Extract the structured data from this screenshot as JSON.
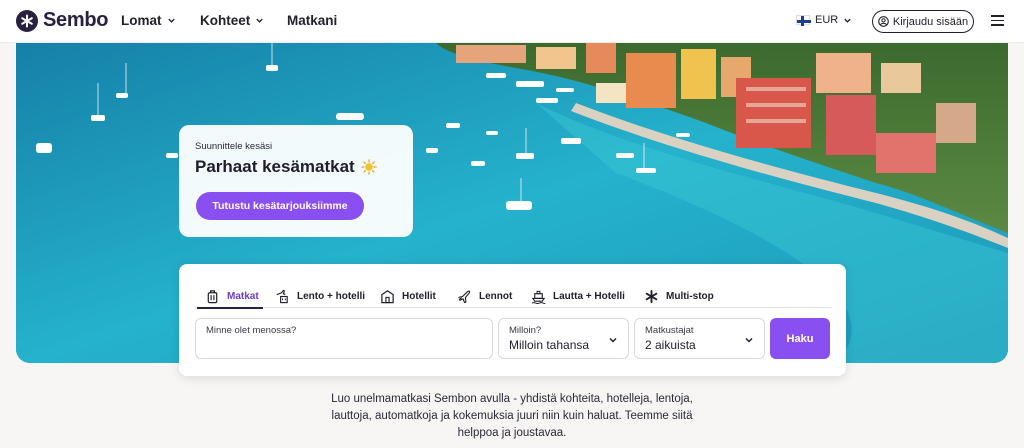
{
  "header": {
    "brand": "Sembo",
    "nav": [
      {
        "label": "Lomat",
        "dropdown": true
      },
      {
        "label": "Kohteet",
        "dropdown": true
      },
      {
        "label": "Matkani",
        "dropdown": false
      }
    ],
    "currency": "EUR",
    "login_label": "Kirjaudu sisään"
  },
  "promo": {
    "subtitle": "Suunnittele kesäsi",
    "title": "Parhaat kesämatkat",
    "button": "Tutustu kesätarjouksiimme"
  },
  "search": {
    "tabs": [
      {
        "label": "Matkat",
        "icon": "luggage-icon",
        "active": true
      },
      {
        "label": "Lento + hotelli",
        "icon": "plane-hotel-icon",
        "active": false
      },
      {
        "label": "Hotellit",
        "icon": "hotel-icon",
        "active": false
      },
      {
        "label": "Lennot",
        "icon": "plane-icon",
        "active": false
      },
      {
        "label": "Lautta + Hotelli",
        "icon": "ferry-icon",
        "active": false
      },
      {
        "label": "Multi-stop",
        "icon": "asterisk-icon",
        "active": false
      }
    ],
    "destination": {
      "placeholder": "Minne olet menossa?"
    },
    "when": {
      "label": "Milloin?",
      "value": "Milloin tahansa"
    },
    "travellers": {
      "label": "Matkustajat",
      "value": "2 aikuista"
    },
    "submit": "Haku"
  },
  "intro_text": "Luo unelmamatkasi Sembon avulla - yhdistä kohteita, hotelleja, lentoja, lauttoja, automatkoja ja kokemuksia juuri niin kuin haluat. Teemme siitä helppoa ja joustavaa.",
  "colors": {
    "brand": "#2a2140",
    "accent": "#8a4ff0",
    "active_tab": "#6b3bd2"
  }
}
